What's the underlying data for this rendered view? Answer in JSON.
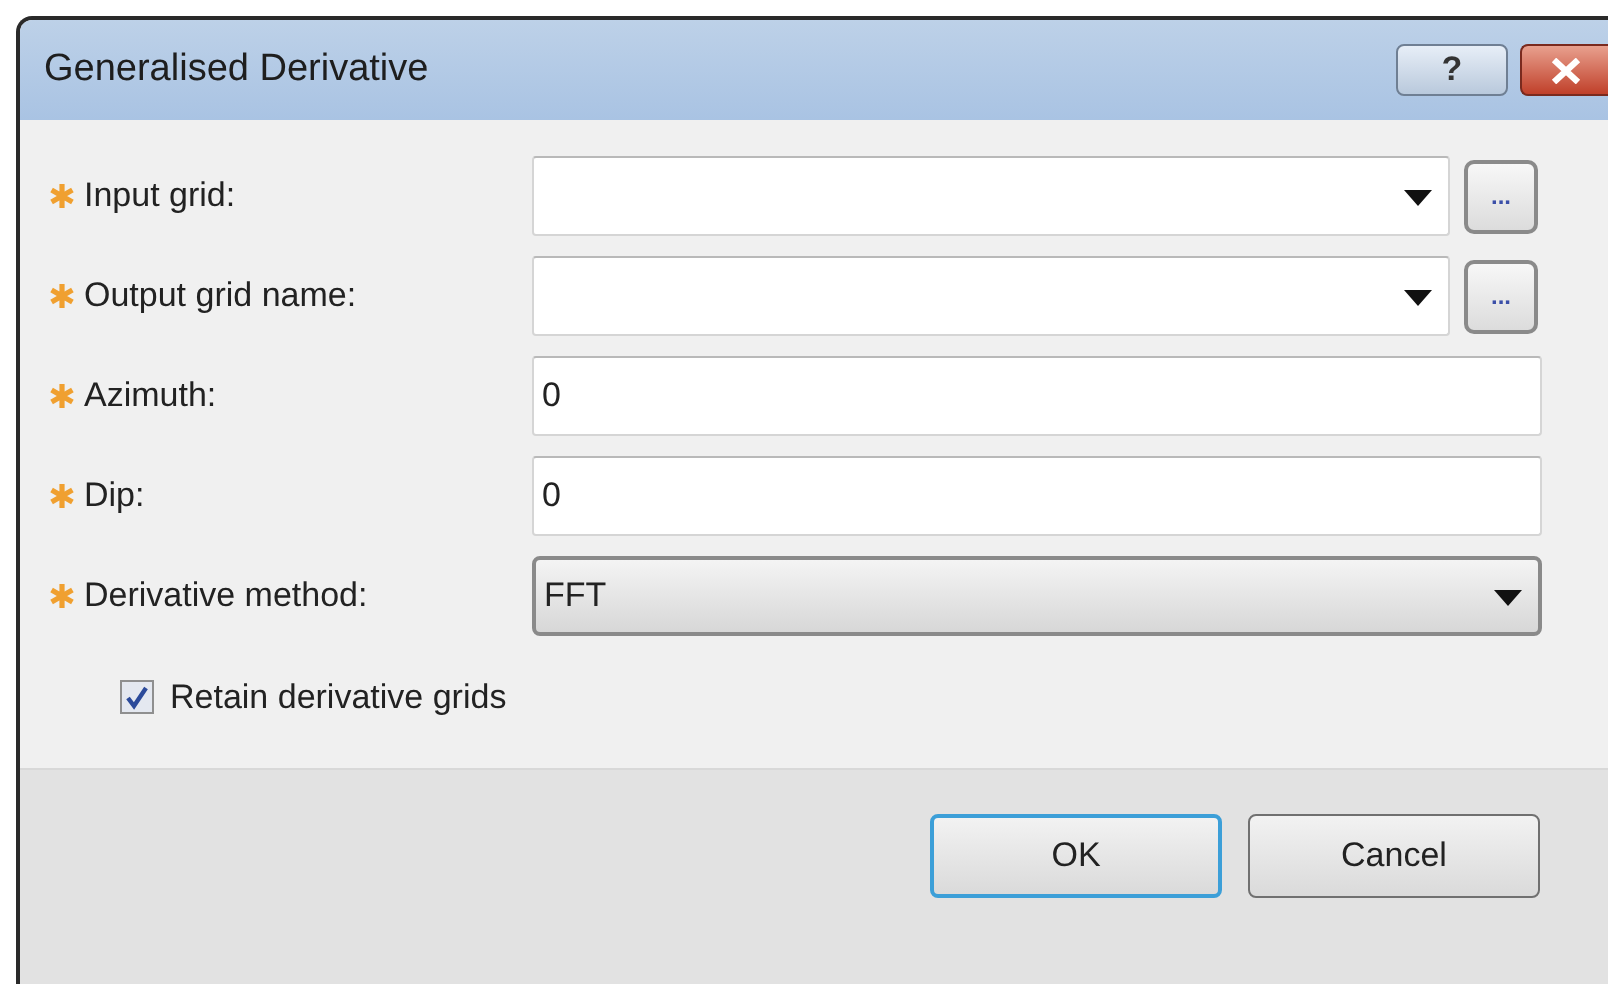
{
  "window": {
    "title": "Generalised Derivative",
    "help_button": "?"
  },
  "fields": [
    {
      "kind": "combo-browse",
      "label": "Input grid:",
      "required": true,
      "browse_label": "..."
    },
    {
      "kind": "combo-browse",
      "label": "Output grid name:",
      "required": true,
      "browse_label": "..."
    },
    {
      "kind": "text",
      "label": "Azimuth:",
      "required": true,
      "value": "0"
    },
    {
      "kind": "text",
      "label": "Dip:",
      "required": true,
      "value": "0"
    },
    {
      "kind": "dropdown",
      "label": "Derivative method:",
      "required": true,
      "value": "FFT"
    }
  ],
  "checkbox": {
    "label": "Retain derivative grids",
    "checked": true
  },
  "buttons": [
    {
      "label": "OK",
      "default": true
    },
    {
      "label": "Cancel",
      "default": false
    }
  ]
}
